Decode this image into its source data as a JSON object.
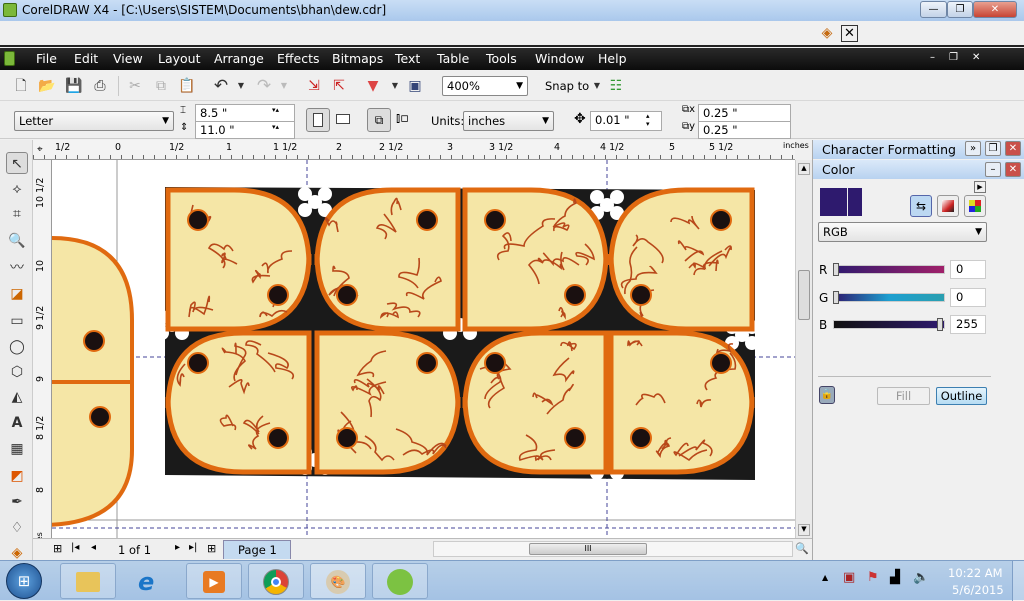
{
  "window": {
    "title": "CorelDRAW X4 - [C:\\Users\\SISTEM\\Documents\\bhan\\dew.cdr]",
    "controls": [
      "minimize",
      "restore",
      "close"
    ]
  },
  "menu": [
    "File",
    "Edit",
    "View",
    "Layout",
    "Arrange",
    "Effects",
    "Bitmaps",
    "Text",
    "Table",
    "Tools",
    "Window",
    "Help"
  ],
  "menu_accel": [
    "F",
    "E",
    "V",
    "L",
    "A",
    "c",
    "B",
    "T",
    "T",
    "o",
    "W",
    "H"
  ],
  "toolbar": {
    "zoom": "400%",
    "snap_to": "Snap to",
    "icons": [
      "new-icon",
      "open-icon",
      "save-icon",
      "print-icon",
      "cut-icon",
      "copy-icon",
      "paste-icon",
      "undo-icon",
      "redo-icon",
      "import-icon",
      "export-icon",
      "application-launcher-icon",
      "welcome-screen-icon",
      "snap-options-icon"
    ]
  },
  "propbar": {
    "paper": "Letter",
    "width": "8.5 \"",
    "height": "11.0 \"",
    "units_label": "Units:",
    "units": "inches",
    "nudge": "0.01 \"",
    "dup_x": "0.25 \"",
    "dup_y": "0.25 \""
  },
  "ruler": {
    "top": [
      "1/2",
      "0",
      "1/2",
      "1",
      "1 1/2",
      "2",
      "2 1/2",
      "3",
      "3 1/2",
      "4",
      "4 1/2",
      "5",
      "5 1/2"
    ],
    "unit": "inches",
    "left": [
      "10 1/2",
      "10",
      "9 1/2",
      "9",
      "8 1/2",
      "8"
    ]
  },
  "toolbox": [
    "pick-tool-icon",
    "shape-tool-icon",
    "crop-tool-icon",
    "zoom-tool-icon",
    "freehand-tool-icon",
    "smart-fill-icon",
    "rectangle-tool-icon",
    "ellipse-tool-icon",
    "polygon-tool-icon",
    "basic-shapes-icon",
    "text-tool-icon",
    "table-tool-icon",
    "interactive-blend-icon",
    "eyedropper-icon",
    "outline-tool-icon",
    "fill-tool-icon"
  ],
  "navbar": {
    "page_count": "1 of 1",
    "page_tab": "Page 1"
  },
  "docker": {
    "panel1": "Character Formatting",
    "panel2": "Color",
    "model": "RGB",
    "channels": [
      {
        "label": "R",
        "value": "0",
        "fraction": 0
      },
      {
        "label": "G",
        "value": "0",
        "fraction": 0
      },
      {
        "label": "B",
        "value": "255",
        "fraction": 1
      }
    ],
    "swatch_color": "#2e1a6e",
    "fill": "Fill",
    "outline": "Outline"
  },
  "colors": {
    "outline": "#e06a10",
    "fill": "#f5e6a6",
    "background": "#1a1a1a",
    "dot": "#1a1010"
  },
  "taskbar": {
    "apps": [
      "start-button",
      "explorer",
      "internet-explorer",
      "media-player",
      "chrome",
      "paint",
      "coreldraw"
    ],
    "time": "10:22 AM",
    "date": "5/6/2015"
  }
}
